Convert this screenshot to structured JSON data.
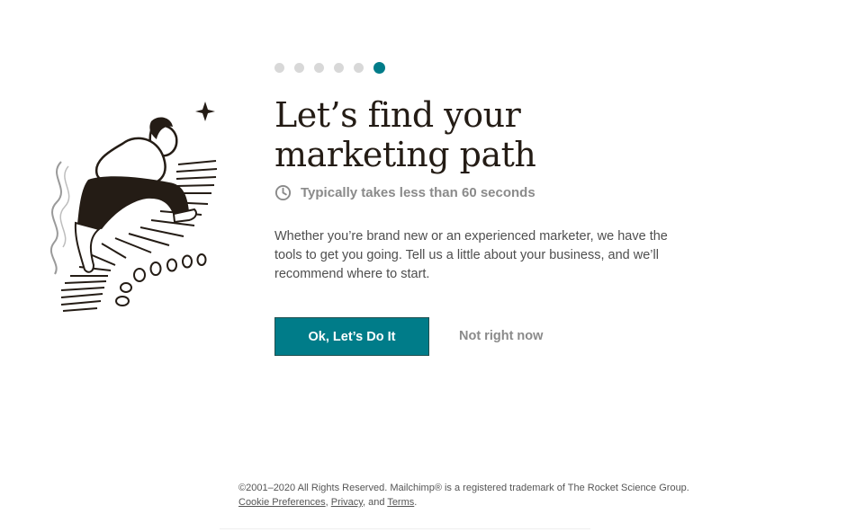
{
  "onboarding": {
    "progress": {
      "total_steps": 6,
      "current_step": 6
    },
    "title": "Let’s find your marketing path",
    "time_estimate": "Typically takes less than 60 seconds",
    "description": "Whether you’re brand new or an experienced marketer, we have the tools to get you going. Tell us a little about your business, and we’ll recommend where to start.",
    "primary_button": "Ok, Let’s Do It",
    "secondary_button": "Not right now",
    "accent_color": "#007c89"
  },
  "footer": {
    "copyright": "©2001–2020 All Rights Reserved. Mailchimp® is a registered trademark of The Rocket Science Group.",
    "links": [
      "Cookie Preferences",
      "Privacy",
      "Terms"
    ],
    "separator_1": ", ",
    "separator_2": ", and ",
    "end": "."
  }
}
